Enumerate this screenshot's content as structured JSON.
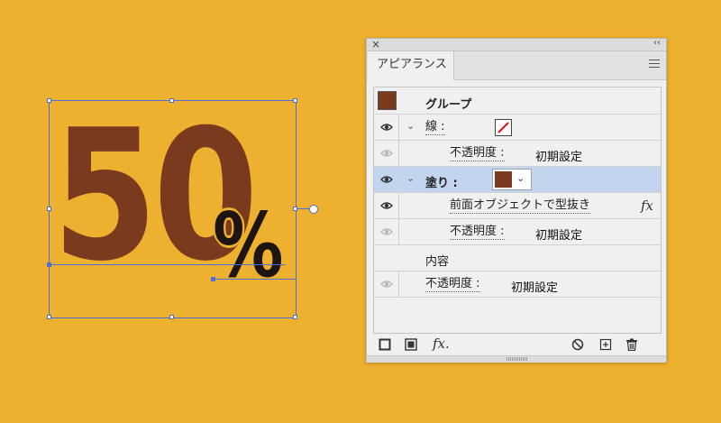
{
  "colors": {
    "background": "#EEB12F",
    "digits": "#7A3A1E",
    "percent": "#1E1410",
    "selection": "#4E6FD6",
    "fill_swatch": "#7A3A1E",
    "selected_row": "#C3D4EE"
  },
  "artwork": {
    "digits": "50",
    "percent": "%"
  },
  "panel": {
    "tab_label": "アピアランス",
    "close_icon": "×",
    "collapse_icon": "‹‹",
    "rows": {
      "group": {
        "label": "グループ"
      },
      "stroke": {
        "label": "線 :",
        "swatch": "none"
      },
      "stroke_opacity": {
        "label": "不透明度 :",
        "value": "初期設定"
      },
      "fill": {
        "label": "塗り :",
        "swatch": "brown"
      },
      "knockout": {
        "label": "前面オブジェクトで型抜き",
        "fx_icon": "fx"
      },
      "fill_opacity": {
        "label": "不透明度 :",
        "value": "初期設定"
      },
      "contents": {
        "label": "内容"
      },
      "group_opacity": {
        "label": "不透明度 :",
        "value": "初期設定"
      }
    },
    "footer_icons": [
      "add-new-stroke-icon",
      "add-new-fill-icon",
      "add-new-effect-icon",
      "clear-appearance-icon",
      "duplicate-item-icon",
      "delete-icon"
    ],
    "footer_fx": "fx."
  }
}
